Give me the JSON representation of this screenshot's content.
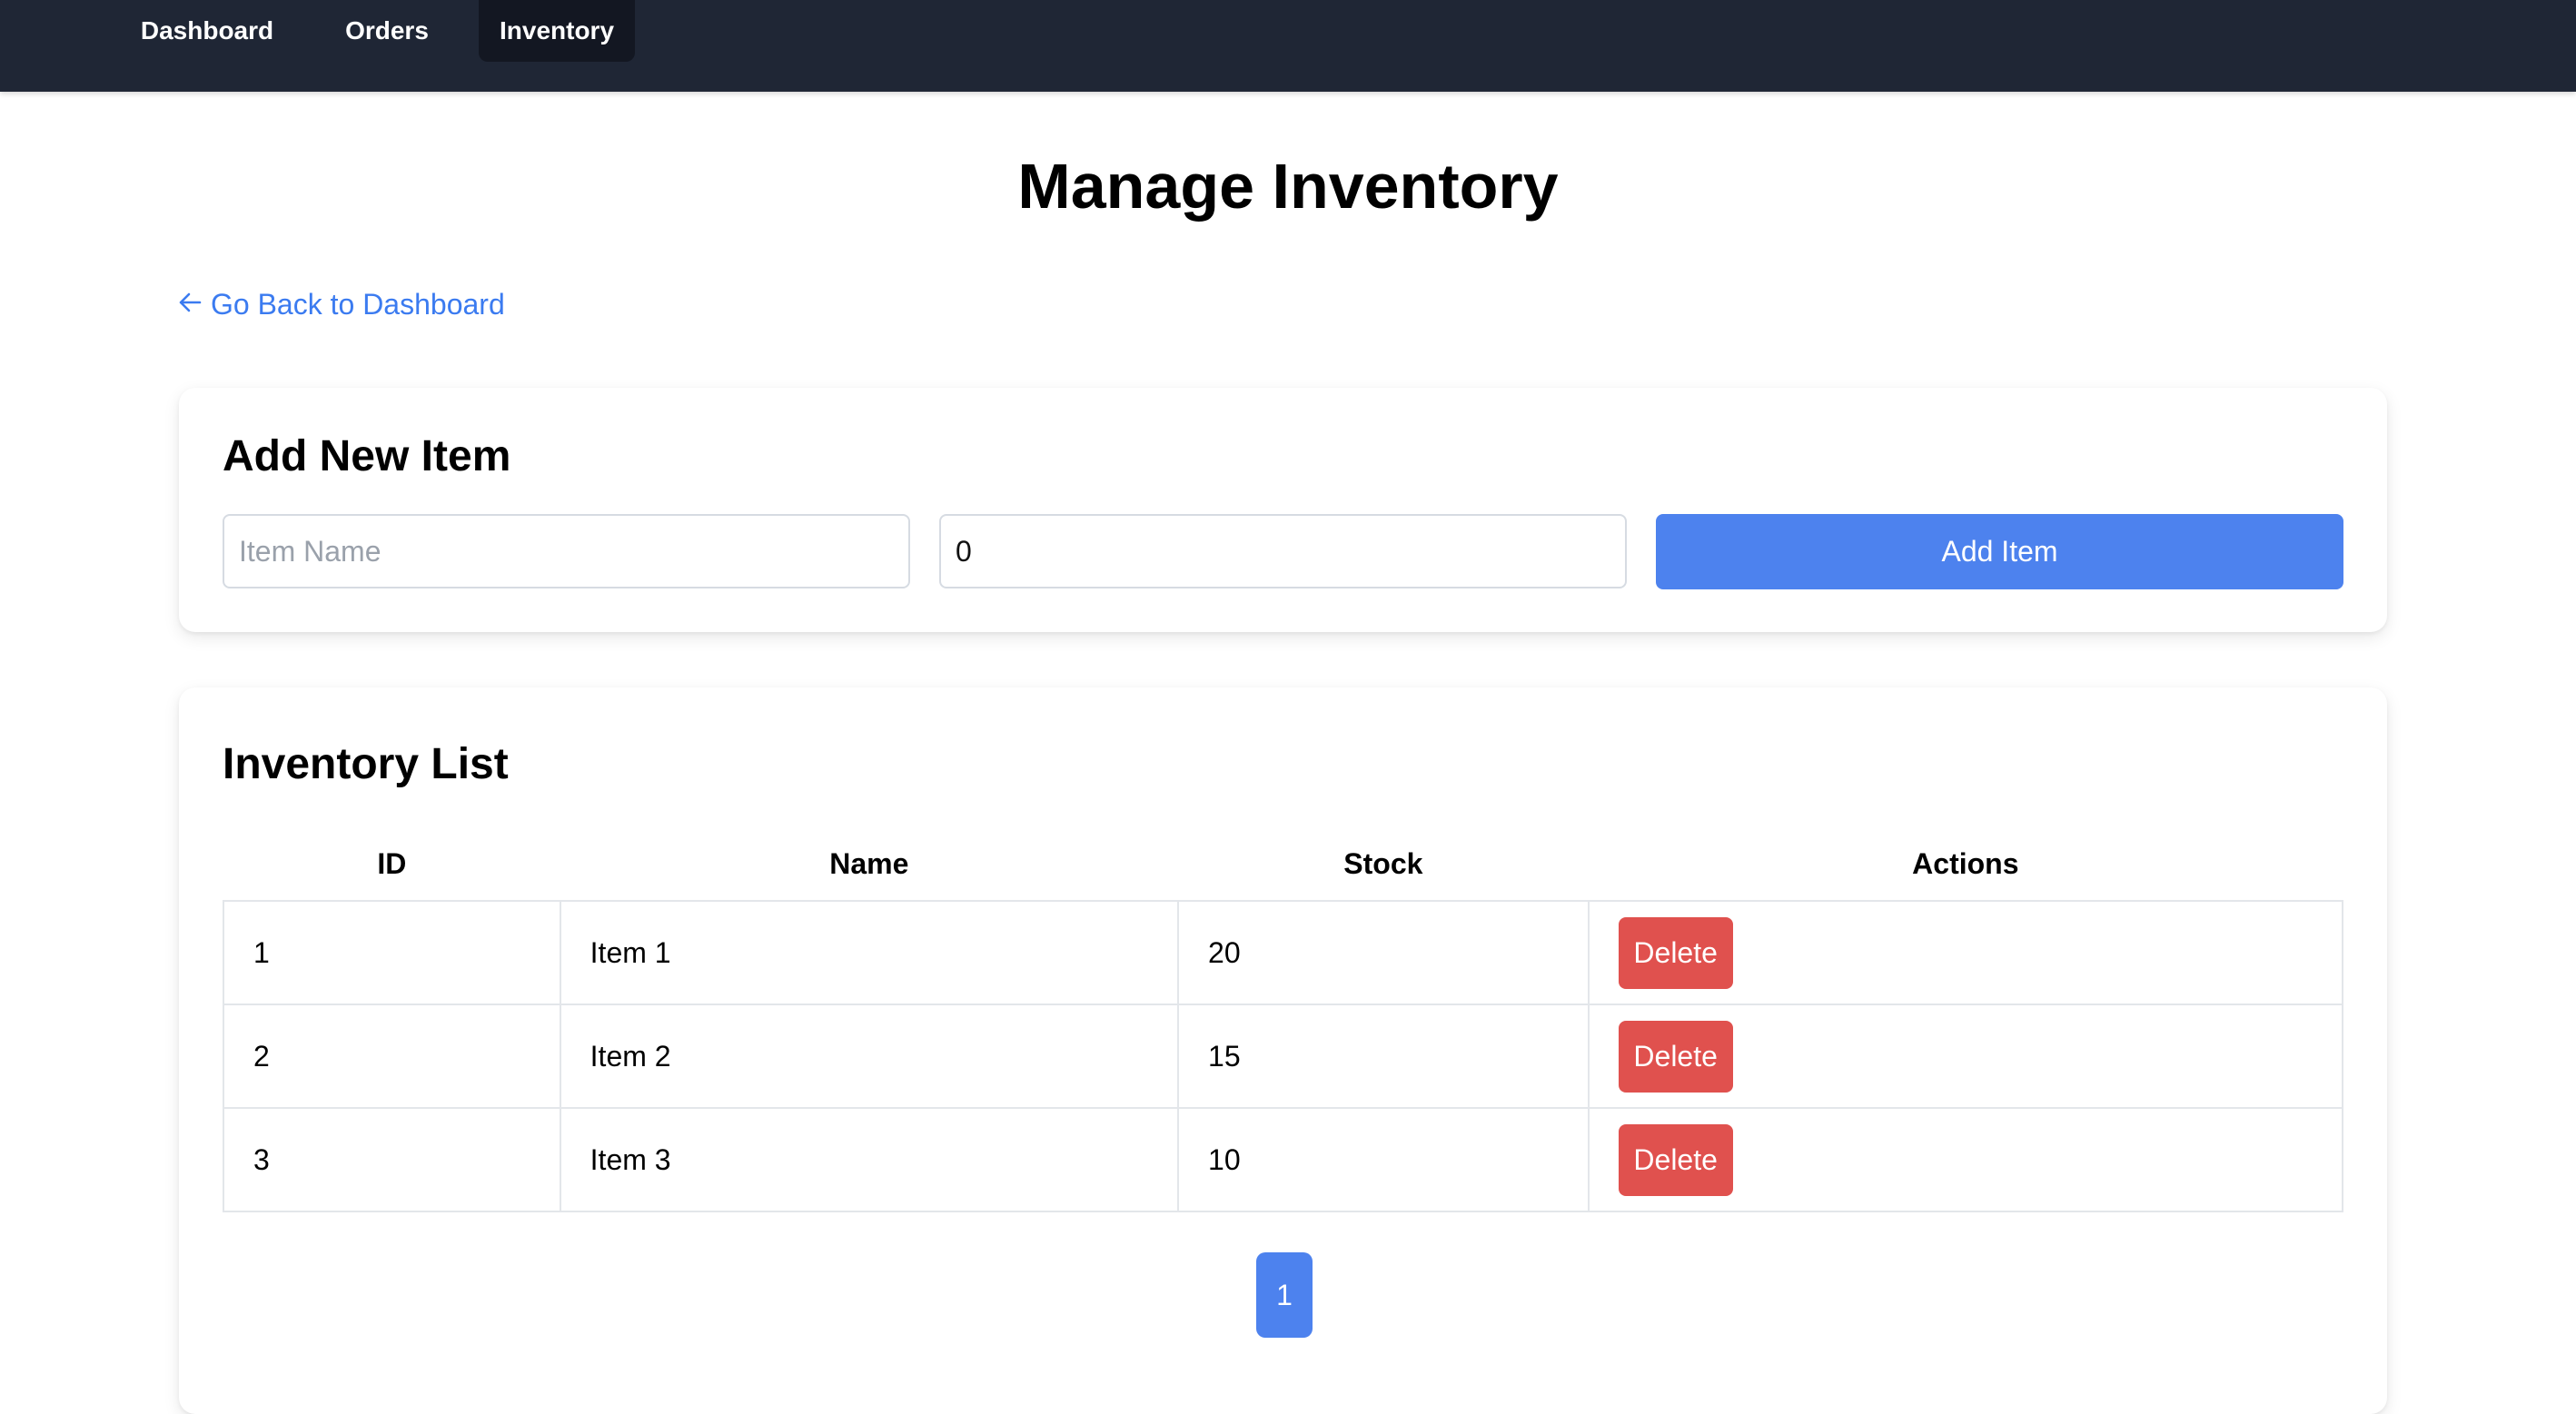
{
  "nav": {
    "items": [
      {
        "label": "Dashboard",
        "active": false
      },
      {
        "label": "Orders",
        "active": false
      },
      {
        "label": "Inventory",
        "active": true
      }
    ],
    "background_color": "#1f2635",
    "active_color": "#131722"
  },
  "page": {
    "title": "Manage Inventory",
    "back_link_icon": "arrow-left-icon",
    "back_link_label": "Go Back to Dashboard"
  },
  "add_item": {
    "title": "Add New Item",
    "name_placeholder": "Item Name",
    "name_value": "",
    "stock_value": "0",
    "submit_label": "Add Item"
  },
  "inventory": {
    "title": "Inventory List",
    "columns": [
      "ID",
      "Name",
      "Stock",
      "Actions"
    ],
    "rows": [
      {
        "id": "1",
        "name": "Item 1",
        "stock": "20",
        "action_label": "Delete"
      },
      {
        "id": "2",
        "name": "Item 2",
        "stock": "15",
        "action_label": "Delete"
      },
      {
        "id": "3",
        "name": "Item 3",
        "stock": "10",
        "action_label": "Delete"
      }
    ],
    "pagination": {
      "current_page": "1"
    }
  },
  "colors": {
    "accent": "#4d82ee",
    "danger": "#e0514e",
    "link": "#3b7bf0"
  }
}
